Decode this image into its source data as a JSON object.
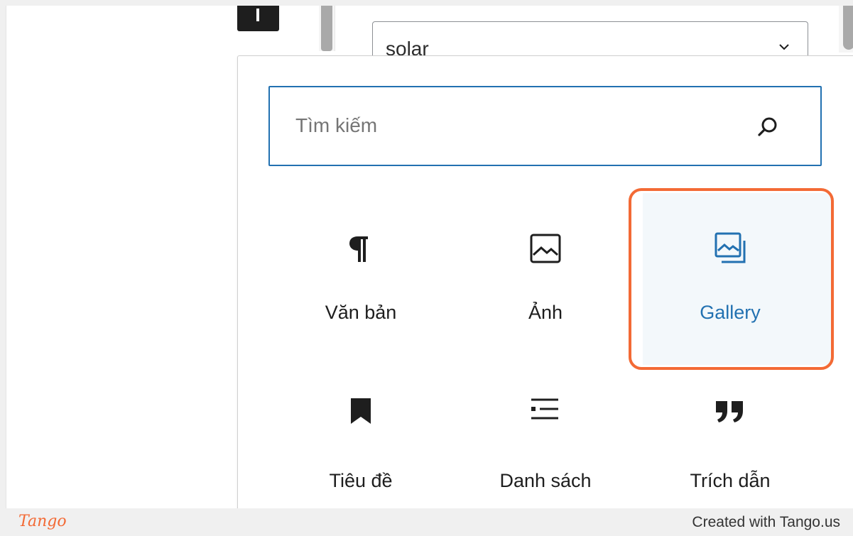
{
  "editor": {
    "select_value": "solar"
  },
  "inserter": {
    "search": {
      "placeholder": "Tìm kiếm",
      "value": ""
    },
    "blocks": [
      {
        "label": "Văn bản",
        "icon": "paragraph-icon"
      },
      {
        "label": "Ảnh",
        "icon": "image-icon"
      },
      {
        "label": "Gallery",
        "icon": "gallery-icon",
        "highlighted": true
      },
      {
        "label": "Tiêu đề",
        "icon": "heading-bookmark-icon"
      },
      {
        "label": "Danh sách",
        "icon": "list-icon"
      },
      {
        "label": "Trích dẫn",
        "icon": "quote-icon"
      }
    ]
  },
  "colors": {
    "accent": "#2271b1",
    "highlight": "#f36a35",
    "text": "#1e1e1e"
  },
  "footer": {
    "brand": "Tango",
    "credit": "Created with Tango.us"
  }
}
